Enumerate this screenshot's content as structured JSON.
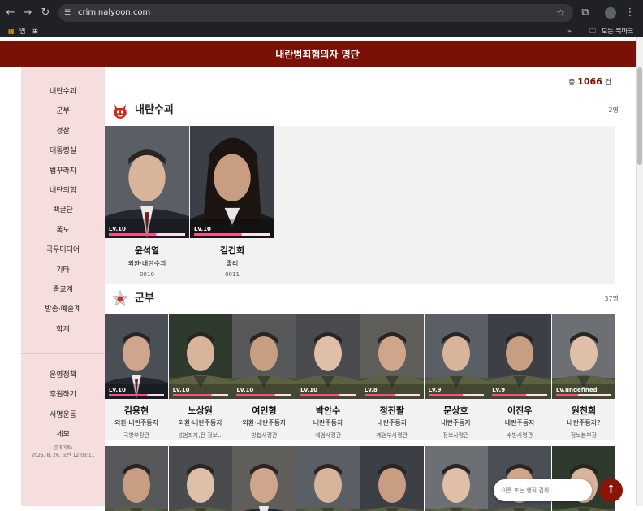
{
  "browser": {
    "url": "criminalyoon.com",
    "bookmark_apps": "앱",
    "bookmark_more": "»",
    "bookmark_all": "모든 북마크"
  },
  "site": {
    "title": "내란범죄혐의자 명단",
    "total_prefix": "총",
    "total_count": "1066",
    "total_suffix": "건"
  },
  "sidebar": {
    "primary": [
      "내란수괴",
      "군부",
      "경찰",
      "대통령실",
      "법꾸라지",
      "내란의힘",
      "백골단",
      "폭도",
      "극우미디어",
      "기타",
      "종교계",
      "방송·예술계",
      "학계"
    ],
    "secondary": [
      "운영정책",
      "후원하기",
      "서명운동",
      "제보"
    ],
    "updated_label": "업데이트:",
    "updated_value": "2025. 8. 26. 오전 12:03:11"
  },
  "sections": [
    {
      "title": "내란수괴",
      "count": "2명",
      "people": [
        {
          "level": "Lv.10",
          "name": "윤석열",
          "role": "외환·내란수괴",
          "sub": "0010",
          "hp": 0.62
        },
        {
          "level": "Lv.10",
          "name": "김건희",
          "role": "줄리",
          "sub": "0011",
          "hp": 0.62
        }
      ]
    },
    {
      "title": "군부",
      "count": "37명",
      "people": [
        {
          "level": "Lv.10",
          "name": "김용현",
          "role": "외환·내란주동자",
          "sub": "국방부장관",
          "hp": 0.7
        },
        {
          "level": "Lv.10",
          "name": "노상원",
          "role": "외환·내란주동자",
          "sub": "성범죄자,전 정보...",
          "hp": 0.7
        },
        {
          "level": "Lv.10",
          "name": "여인형",
          "role": "외환·내란주동자",
          "sub": "방첩사령관",
          "hp": 0.7
        },
        {
          "level": "Lv.10",
          "name": "박안수",
          "role": "내란주동자",
          "sub": "계엄사령관",
          "hp": 0.7
        },
        {
          "level": "Lv.8",
          "name": "정진팔",
          "role": "내란주동자",
          "sub": "계엄부사령관",
          "hp": 0.55
        },
        {
          "level": "Lv.9",
          "name": "문상호",
          "role": "내란주동자",
          "sub": "정보사령관",
          "hp": 0.62
        },
        {
          "level": "Lv.9",
          "name": "이진우",
          "role": "내란주동자",
          "sub": "수방사령관",
          "hp": 0.62
        },
        {
          "level": "Lv.undefined",
          "name": "원천희",
          "role": "내란주동자?",
          "sub": "정보본부장",
          "hp": 0.4
        }
      ]
    }
  ],
  "search": {
    "placeholder": "이름 또는 행적 검색..."
  },
  "colors": {
    "brand": "#7b1106",
    "sidebar_bg": "#f7dede",
    "hp": "#ff4f86"
  }
}
